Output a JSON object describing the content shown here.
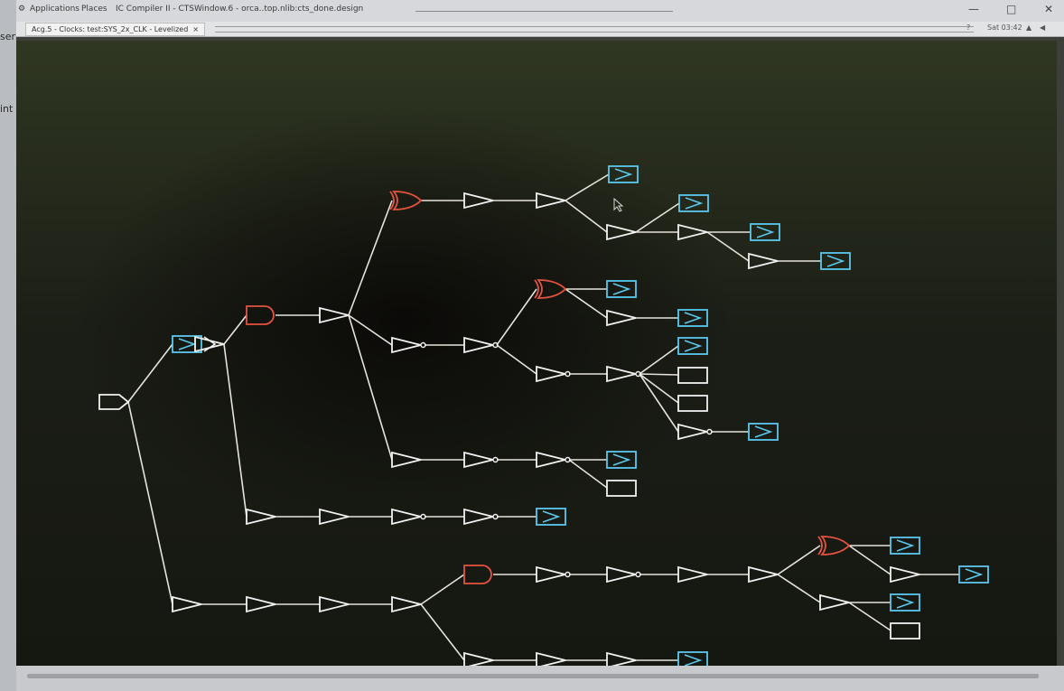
{
  "topbar": {
    "applications": "Applications",
    "places": "Places",
    "window_title": "IC Compiler II - CTSWindow.6 - orca..top.nlib:cts_done.design"
  },
  "tab": {
    "label": "Acg.5 - Clocks: test:SYS_2x_CLK - Levelized"
  },
  "system": {
    "clock": "Sat 03:42"
  },
  "left_strip": {
    "text1": "ser",
    "text2": "int"
  },
  "colors": {
    "wire": "#e6e3dc",
    "buffer": "#f2f2f2",
    "gate": "#e5533f",
    "flop": "#5bc8ee",
    "canvas": "#20241a"
  },
  "clock_tree": {
    "root": {
      "kind": "port"
    },
    "element_kinds": [
      "port",
      "buffer",
      "inverter",
      "and-gate",
      "xor-gate",
      "flop",
      "blank-cell"
    ]
  }
}
